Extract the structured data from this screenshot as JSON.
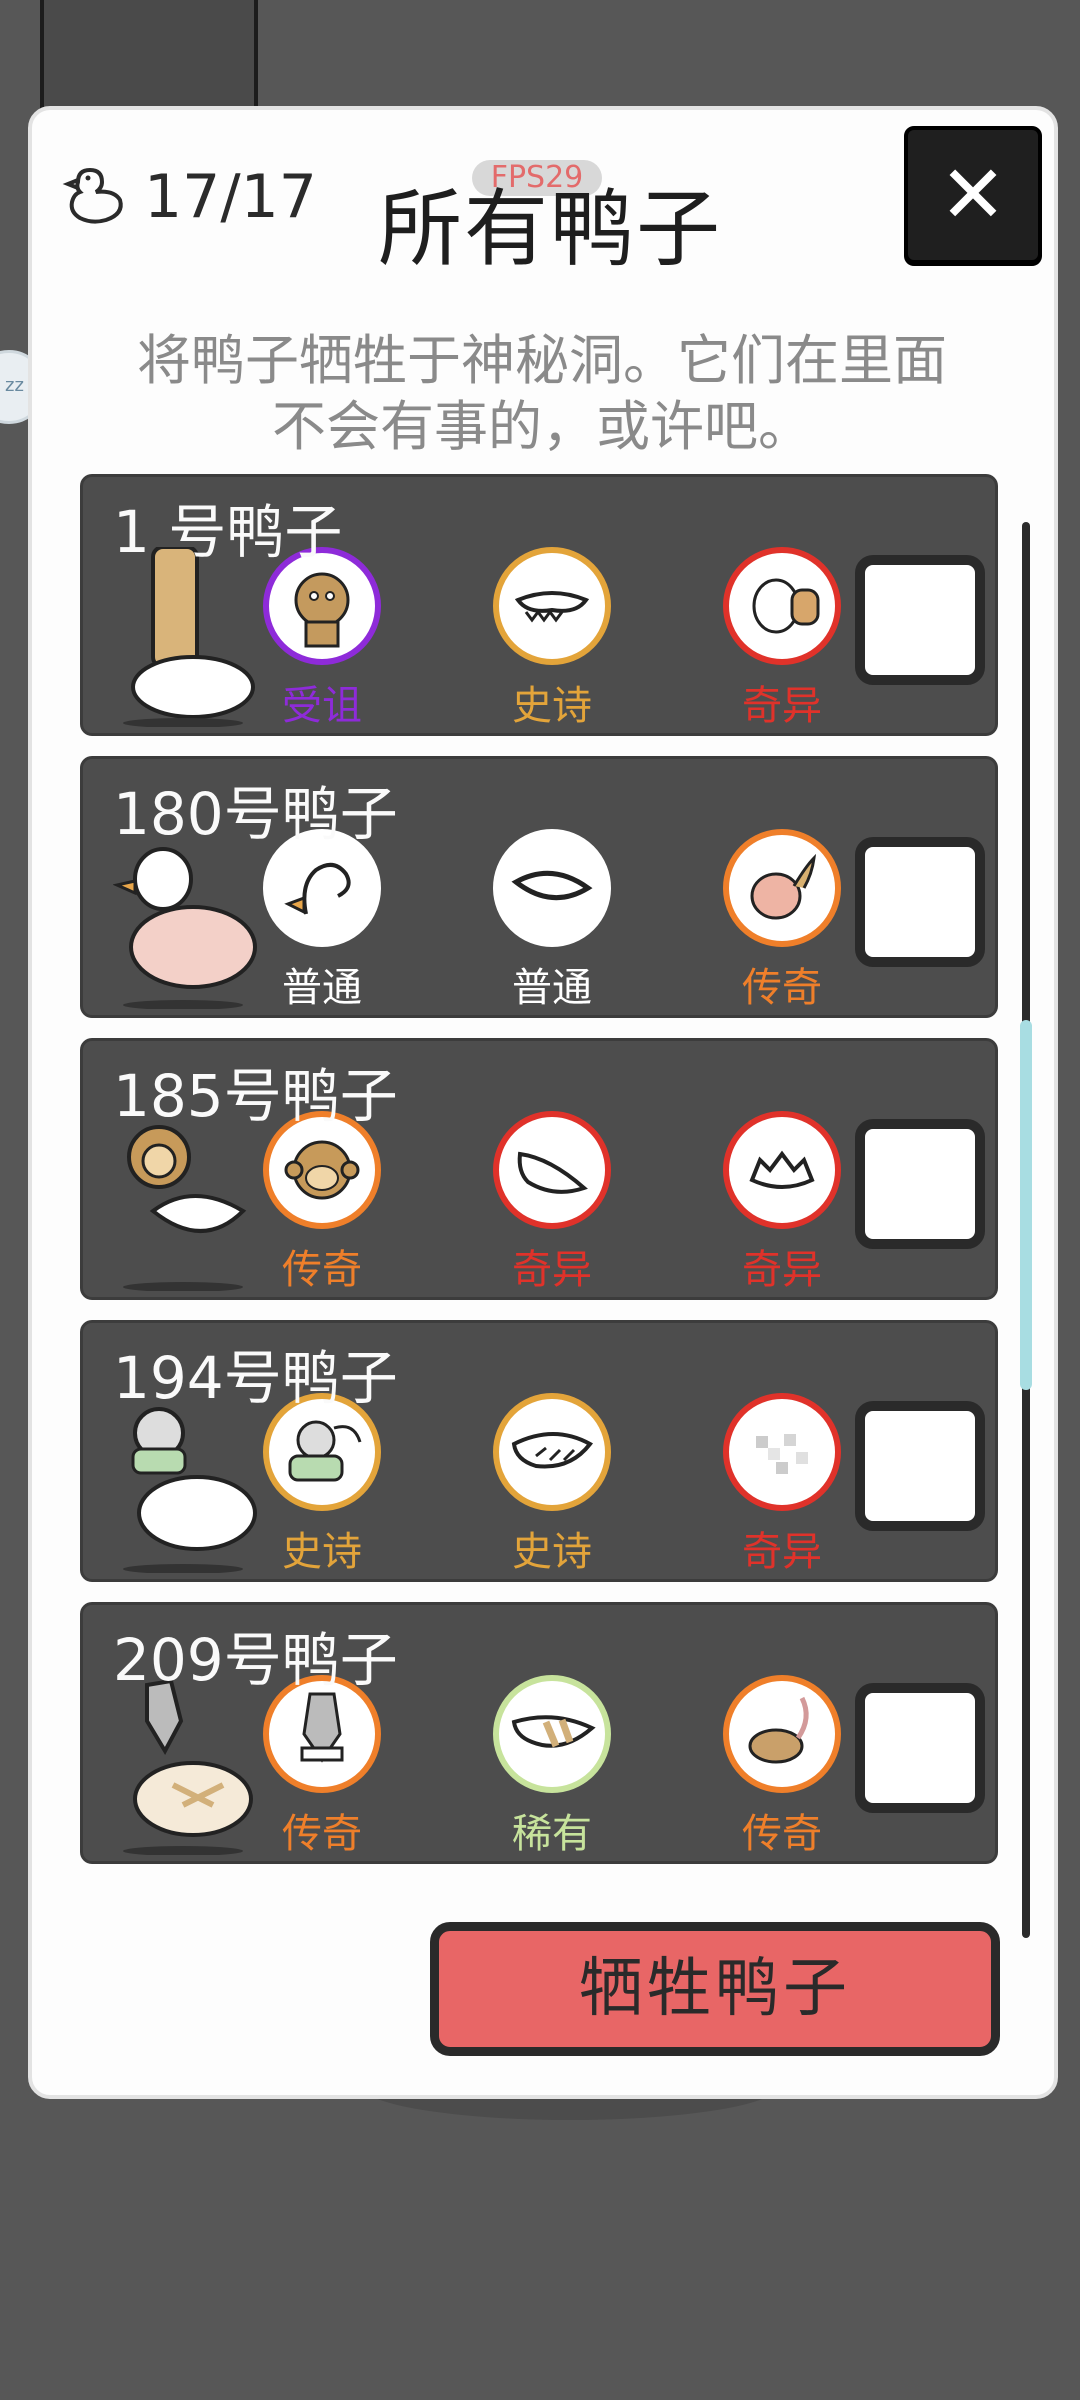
{
  "header": {
    "duck_count": "17/17",
    "fps": "FPS29",
    "title": "所有鸭子",
    "close_symbol": "✕",
    "description": "将鸭子牺牲于神秘洞。它们在里面不会有事的，或许吧。"
  },
  "side_bubble": {
    "text": "zz"
  },
  "colors": {
    "cursed": "#8e2bd9",
    "epic": "#e3a43a",
    "strange": "#e0322a",
    "legendary": "#ef7f2a",
    "common": "#ffffff",
    "rare": "#c7e39c",
    "primary_button": "#e86666"
  },
  "ducks": [
    {
      "name": "1  号鸭子",
      "parts": [
        {
          "rarity": "受诅",
          "icon": "brown-creature-icon",
          "color": "#8e2bd9"
        },
        {
          "rarity": "史诗",
          "icon": "bow-tie-icon",
          "color": "#e3a43a"
        },
        {
          "rarity": "奇异",
          "icon": "egg-hat-icon",
          "color": "#e0322a"
        }
      ]
    },
    {
      "name": "180号鸭子",
      "parts": [
        {
          "rarity": "普通",
          "icon": "duck-head-icon",
          "color": "#ffffff"
        },
        {
          "rarity": "普通",
          "icon": "duck-body-icon",
          "color": "#ffffff"
        },
        {
          "rarity": "传奇",
          "icon": "dragon-icon",
          "color": "#ef7f2a"
        }
      ]
    },
    {
      "name": "185号鸭子",
      "parts": [
        {
          "rarity": "传奇",
          "icon": "monkey-head-icon",
          "color": "#ef7f2a"
        },
        {
          "rarity": "奇异",
          "icon": "feather-wing-icon",
          "color": "#e0322a"
        },
        {
          "rarity": "奇异",
          "icon": "spiky-body-icon",
          "color": "#e0322a"
        }
      ]
    },
    {
      "name": "194号鸭子",
      "parts": [
        {
          "rarity": "史诗",
          "icon": "masked-head-icon",
          "color": "#e3a43a"
        },
        {
          "rarity": "史诗",
          "icon": "wing-icon",
          "color": "#e3a43a"
        },
        {
          "rarity": "奇异",
          "icon": "pixel-body-icon",
          "color": "#e0322a"
        }
      ]
    },
    {
      "name": "209号鸭子",
      "parts": [
        {
          "rarity": "传奇",
          "icon": "sword-head-icon",
          "color": "#ef7f2a"
        },
        {
          "rarity": "稀有",
          "icon": "bandaged-wing-icon",
          "color": "#c7e39c"
        },
        {
          "rarity": "传奇",
          "icon": "rat-tail-icon",
          "color": "#ef7f2a"
        }
      ]
    }
  ],
  "sacrifice_button": {
    "label": "牺牲鸭子"
  }
}
